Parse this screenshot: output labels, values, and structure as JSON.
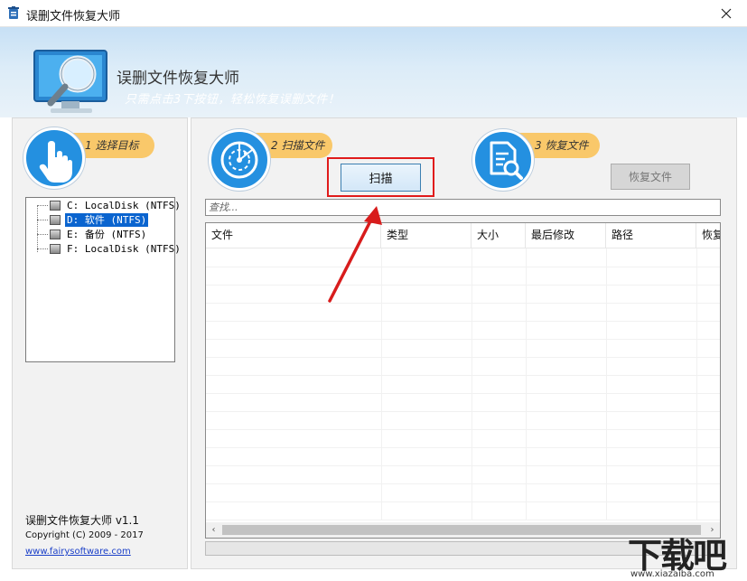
{
  "window": {
    "title": "误删文件恢复大师",
    "close_icon": "close-icon"
  },
  "banner": {
    "app_name": "误删文件恢复大师",
    "slogan": "只需点击3下按钮，轻松恢复误删文件！",
    "logo_icon": "monitor-magnifier-logo"
  },
  "steps": [
    {
      "label": "1 选择目标",
      "icon": "hand-pointer-icon"
    },
    {
      "label": "2 扫描文件",
      "icon": "radar-scan-icon"
    },
    {
      "label": "3 恢复文件",
      "icon": "document-search-icon"
    }
  ],
  "drives": [
    {
      "label": "C: LocalDisk (NTFS)",
      "selected": false
    },
    {
      "label": "D: 软件 (NTFS)",
      "selected": true
    },
    {
      "label": "E: 备份 (NTFS)",
      "selected": false
    },
    {
      "label": "F: LocalDisk (NTFS)",
      "selected": false
    }
  ],
  "footer": {
    "version": "误删文件恢复大师 v1.1",
    "copyright": "Copyright (C) 2009 - 2017",
    "link": "www.fairysoftware.com"
  },
  "buttons": {
    "scan": "扫描",
    "recover": "恢复文件"
  },
  "search": {
    "placeholder": "查找..."
  },
  "table": {
    "columns": [
      "文件",
      "类型",
      "大小",
      "最后修改",
      "路径",
      "恢复"
    ]
  },
  "watermark": {
    "big": "下载吧",
    "small": "www.xiazaiba.com"
  },
  "colors": {
    "accent_blue": "#2490e0",
    "step_pill": "#f9c86a",
    "highlight_red": "#e01b1b",
    "selection": "#0a64cf"
  }
}
